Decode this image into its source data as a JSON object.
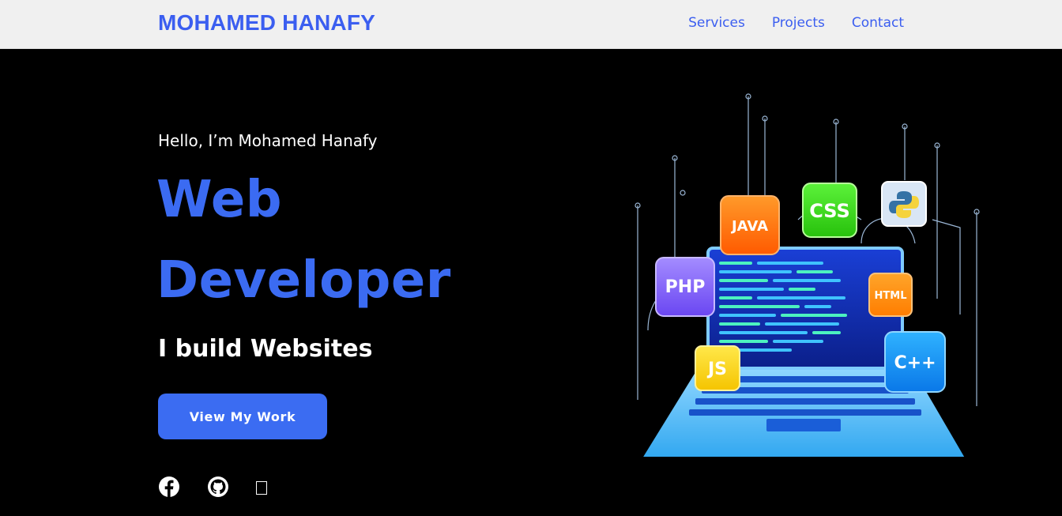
{
  "header": {
    "brand": "MOHAMED HANAFY",
    "nav": [
      "Services",
      "Projects",
      "Contact"
    ]
  },
  "hero": {
    "greeting": "Hello, I’m Mohamed Hanafy",
    "title_line1": "Web",
    "title_line2": "Developer",
    "tagline": "I build Websites",
    "cta_label": "View My Work"
  },
  "illustration": {
    "badges": [
      "JAVA",
      "CSS",
      "PHP",
      "HTML",
      "JS",
      "C++"
    ],
    "python_icon": "python-icon"
  },
  "socials": [
    "facebook-icon",
    "github-icon",
    "missing-glyph-icon"
  ],
  "colors": {
    "accent": "#3b6cf2",
    "navbar_bg": "#f0f0f0",
    "hero_bg": "#000000"
  }
}
